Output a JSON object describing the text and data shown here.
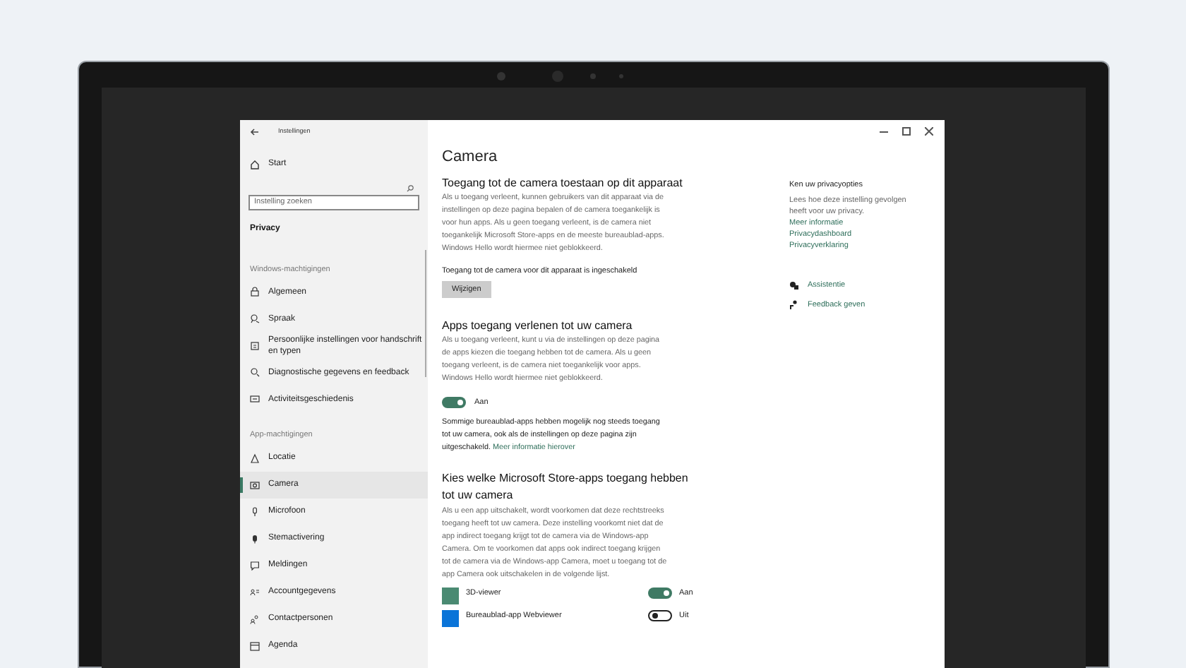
{
  "window": {
    "title": "Instellingen"
  },
  "sidebar": {
    "home": "Start",
    "search": {
      "placeholder": "Instelling zoeken"
    },
    "category": "Privacy",
    "groups": [
      {
        "heading": "Windows-machtigingen",
        "items": [
          {
            "label": "Algemeen",
            "selected": false
          },
          {
            "label": "Spraak",
            "selected": false
          },
          {
            "label": "Persoonlijke instellingen voor handschrift en typen",
            "selected": false
          },
          {
            "label": "Diagnostische gegevens en feedback",
            "selected": false
          },
          {
            "label": "Activiteitsgeschiedenis",
            "selected": false
          }
        ]
      },
      {
        "heading": "App-machtigingen",
        "items": [
          {
            "label": "Locatie",
            "selected": false
          },
          {
            "label": "Camera",
            "selected": true
          },
          {
            "label": "Microfoon",
            "selected": false
          },
          {
            "label": "Stemactivering",
            "selected": false
          },
          {
            "label": "Meldingen",
            "selected": false
          },
          {
            "label": "Accountgegevens",
            "selected": false
          },
          {
            "label": "Contactpersonen",
            "selected": false
          },
          {
            "label": "Agenda",
            "selected": false
          }
        ]
      }
    ]
  },
  "page": {
    "title": "Camera",
    "device_section": {
      "heading": "Toegang tot de camera toestaan op dit apparaat",
      "text": "Als u toegang verleent, kunnen gebruikers van dit apparaat via de instellingen op deze pagina bepalen of de camera toegankelijk is voor hun apps. Als u geen toegang verleent, is de camera niet toegankelijk Microsoft Store-apps en de meeste bureaublad-apps. Windows Hello wordt hiermee niet geblokkeerd.",
      "status": "Toegang tot de camera voor dit apparaat is ingeschakeld",
      "button": "Wijzigen"
    },
    "apps_section": {
      "heading": "Apps toegang verlenen tot uw camera",
      "text": "Als u toegang verleent, kunt u via de instellingen op deze pagina de apps kiezen die toegang hebben tot de camera. Als u geen toegang verleent, is de camera niet toegankelijk voor apps. Windows Hello wordt hiermee niet geblokkeerd.",
      "toggle": {
        "on": true,
        "label": "Aan"
      },
      "note": "Sommige bureaublad-apps hebben mogelijk nog steeds toegang tot uw camera, ook als de instellingen op deze pagina zijn uitgeschakeld.",
      "note_link": "Meer informatie hierover"
    },
    "store_section": {
      "heading": "Kies welke Microsoft Store-apps toegang hebben tot uw camera",
      "text": "Als u een app uitschakelt, wordt voorkomen dat deze rechtstreeks toegang heeft tot uw camera. Deze instelling voorkomt niet dat de app indirect toegang krijgt tot de camera via de Windows-app Camera. Om te voorkomen dat apps ook indirect toegang krijgen tot de camera via de Windows-app Camera, moet u toegang tot de app Camera ook uitschakelen in de volgende lijst.",
      "apps": [
        {
          "name": "3D-viewer",
          "on": true,
          "label": "Aan",
          "color": "#4a8a72"
        },
        {
          "name": "Bureaublad-app Webviewer",
          "on": false,
          "label": "Uit",
          "color": "#0a74d8"
        }
      ]
    }
  },
  "aside": {
    "heading": "Ken uw privacyopties",
    "text": "Lees hoe deze instelling gevolgen heeft voor uw privacy.",
    "links": [
      "Meer informatie",
      "Privacydashboard",
      "Privacyverklaring"
    ],
    "help": [
      "Assistentie",
      "Feedback geven"
    ]
  }
}
